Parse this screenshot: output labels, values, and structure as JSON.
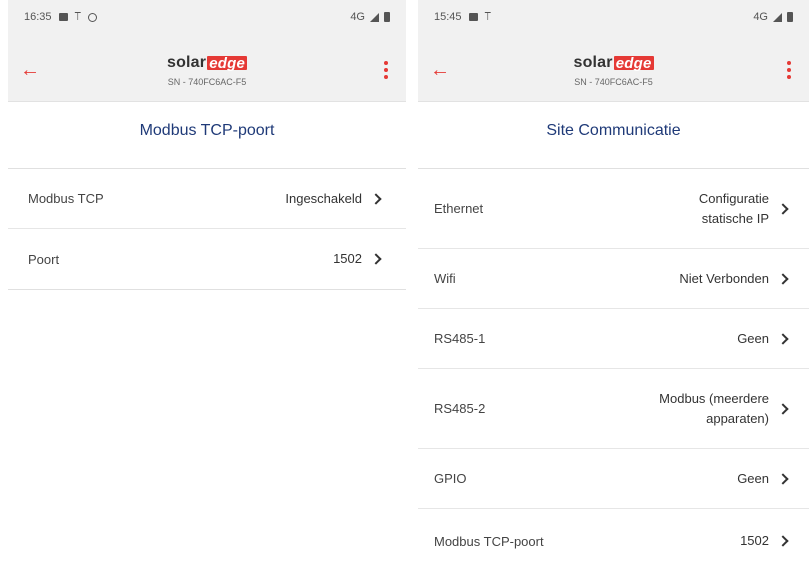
{
  "left": {
    "status": {
      "time": "16:35",
      "network": "4G"
    },
    "header": {
      "logo_main": "solar",
      "logo_accent": "edge",
      "serial": "SN - 740FC6AC-F5"
    },
    "title": "Modbus TCP-poort",
    "rows": [
      {
        "label": "Modbus TCP",
        "value": "Ingeschakeld"
      },
      {
        "label": "Poort",
        "value": "1502"
      }
    ]
  },
  "right": {
    "status": {
      "time": "15:45",
      "network": "4G"
    },
    "header": {
      "logo_main": "solar",
      "logo_accent": "edge",
      "serial": "SN - 740FC6AC-F5"
    },
    "title": "Site Communicatie",
    "rows": [
      {
        "label": "Ethernet",
        "value_line1": "Configuratie",
        "value_line2": "statische IP"
      },
      {
        "label": "Wifi",
        "value": "Niet Verbonden"
      },
      {
        "label": "RS485-1",
        "value": "Geen"
      },
      {
        "label": "RS485-2",
        "value_line1": "Modbus (meerdere",
        "value_line2": "apparaten)"
      },
      {
        "label": "GPIO",
        "value": "Geen"
      },
      {
        "label": "Modbus TCP-poort",
        "value": "1502"
      }
    ]
  },
  "icons": {
    "back": "arrow-left-icon",
    "menu": "more-vertical-icon",
    "chevron": "chevron-right-icon"
  },
  "colors": {
    "accent": "#e53935",
    "title": "#1f3a78",
    "appbar": "#f1f1f1"
  }
}
